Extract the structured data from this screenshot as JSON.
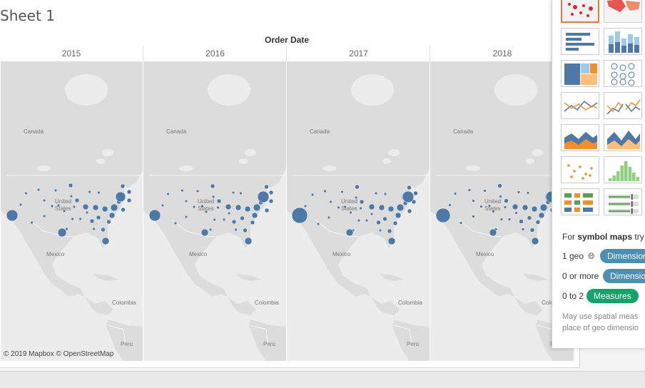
{
  "sheet": {
    "title": "Sheet 1"
  },
  "columns": {
    "field": "Order Date",
    "years": [
      "2015",
      "2016",
      "2017",
      "2018"
    ]
  },
  "map": {
    "labels": {
      "canada": "Canada",
      "us_line1": "United",
      "us_line2": "States",
      "mexico": "Mexico",
      "colombia": "Colombia",
      "peru": "Peru"
    },
    "attribution": "© 2019 Mapbox © OpenStreetMap",
    "marker_color": "#4e79a7",
    "land_color": "#dcdcdc",
    "water_color": "#ececec"
  },
  "show_me": {
    "chart_types": [
      "symbol-map",
      "filled-map",
      "horizontal-bars",
      "stacked-bars",
      "treemap",
      "circle-views",
      "lines-continuous",
      "dual-lines",
      "area-chart",
      "stacked-area",
      "box-plot",
      "histogram",
      "gantt",
      "bullet-graph"
    ],
    "selected": "symbol-map",
    "hint_prefix": "For ",
    "hint_bold": "symbol maps",
    "hint_suffix": " try",
    "requirements": [
      {
        "count": "1 geo",
        "icon": "globe-icon",
        "pill": "Dimension",
        "kind": "dimension"
      },
      {
        "count": "0 or more",
        "pill": "Dimension",
        "kind": "dimension"
      },
      {
        "count": "0 to 2",
        "pill": "Measures",
        "kind": "measure"
      }
    ],
    "note_line1": "May use spatial meas",
    "note_line2": "place of geo dimensio"
  }
}
